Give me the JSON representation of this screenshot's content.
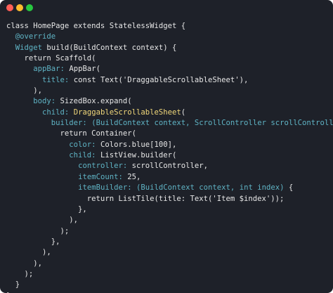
{
  "window": {
    "buttons": [
      {
        "name": "close",
        "color": "#ff5f57"
      },
      {
        "name": "minimize",
        "color": "#febc2e"
      },
      {
        "name": "maximize",
        "color": "#28c840"
      }
    ],
    "background": "#1e2129"
  },
  "code": {
    "lines": [
      [
        {
          "t": "class HomePage extends StatelessWidget {",
          "c": "default"
        }
      ],
      [
        {
          "t": "  ",
          "c": "default"
        },
        {
          "t": "@override",
          "c": "anno"
        }
      ],
      [
        {
          "t": "  ",
          "c": "default"
        },
        {
          "t": "Widget",
          "c": "prop"
        },
        {
          "t": " build(BuildContext context) {",
          "c": "default"
        }
      ],
      [
        {
          "t": "    return Scaffold(",
          "c": "default"
        }
      ],
      [
        {
          "t": "      ",
          "c": "default"
        },
        {
          "t": "appBar:",
          "c": "prop"
        },
        {
          "t": " AppBar(",
          "c": "default"
        }
      ],
      [
        {
          "t": "        ",
          "c": "default"
        },
        {
          "t": "title:",
          "c": "prop"
        },
        {
          "t": " const Text('DraggableScrollableSheet'),",
          "c": "default"
        }
      ],
      [
        {
          "t": "      ),",
          "c": "default"
        }
      ],
      [
        {
          "t": "      ",
          "c": "default"
        },
        {
          "t": "body:",
          "c": "prop"
        },
        {
          "t": " SizedBox.expand(",
          "c": "default"
        }
      ],
      [
        {
          "t": "        ",
          "c": "default"
        },
        {
          "t": "child:",
          "c": "prop"
        },
        {
          "t": " ",
          "c": "default"
        },
        {
          "t": "DraggableScrollableSheet",
          "c": "class-hl"
        },
        {
          "t": "(",
          "c": "default"
        }
      ],
      [
        {
          "t": "          ",
          "c": "default"
        },
        {
          "t": "builder:",
          "c": "prop"
        },
        {
          "t": " ",
          "c": "default"
        },
        {
          "t": "(BuildContext context, ScrollController scrollController)",
          "c": "params"
        },
        {
          "t": " {",
          "c": "default"
        }
      ],
      [
        {
          "t": "            return Container(",
          "c": "default"
        }
      ],
      [
        {
          "t": "              ",
          "c": "default"
        },
        {
          "t": "color:",
          "c": "prop"
        },
        {
          "t": " Colors.blue[100],",
          "c": "default"
        }
      ],
      [
        {
          "t": "              ",
          "c": "default"
        },
        {
          "t": "child:",
          "c": "prop"
        },
        {
          "t": " ListView.builder(",
          "c": "default"
        }
      ],
      [
        {
          "t": "                ",
          "c": "default"
        },
        {
          "t": "controller:",
          "c": "prop"
        },
        {
          "t": " scrollController,",
          "c": "default"
        }
      ],
      [
        {
          "t": "                ",
          "c": "default"
        },
        {
          "t": "itemCount:",
          "c": "prop"
        },
        {
          "t": " 25,",
          "c": "default"
        }
      ],
      [
        {
          "t": "                ",
          "c": "default"
        },
        {
          "t": "itemBuilder:",
          "c": "prop"
        },
        {
          "t": " ",
          "c": "default"
        },
        {
          "t": "(BuildContext context, int index)",
          "c": "params"
        },
        {
          "t": " {",
          "c": "default"
        }
      ],
      [
        {
          "t": "                  return ListTile(title: Text('Item $index'));",
          "c": "default"
        }
      ],
      [
        {
          "t": "                },",
          "c": "default"
        }
      ],
      [
        {
          "t": "              ),",
          "c": "default"
        }
      ],
      [
        {
          "t": "            );",
          "c": "default"
        }
      ],
      [
        {
          "t": "          },",
          "c": "default"
        }
      ],
      [
        {
          "t": "        ),",
          "c": "default"
        }
      ],
      [
        {
          "t": "      ),",
          "c": "default"
        }
      ],
      [
        {
          "t": "    );",
          "c": "default"
        }
      ],
      [
        {
          "t": "  }",
          "c": "default"
        }
      ],
      [
        {
          "t": "}",
          "c": "default"
        }
      ]
    ]
  }
}
